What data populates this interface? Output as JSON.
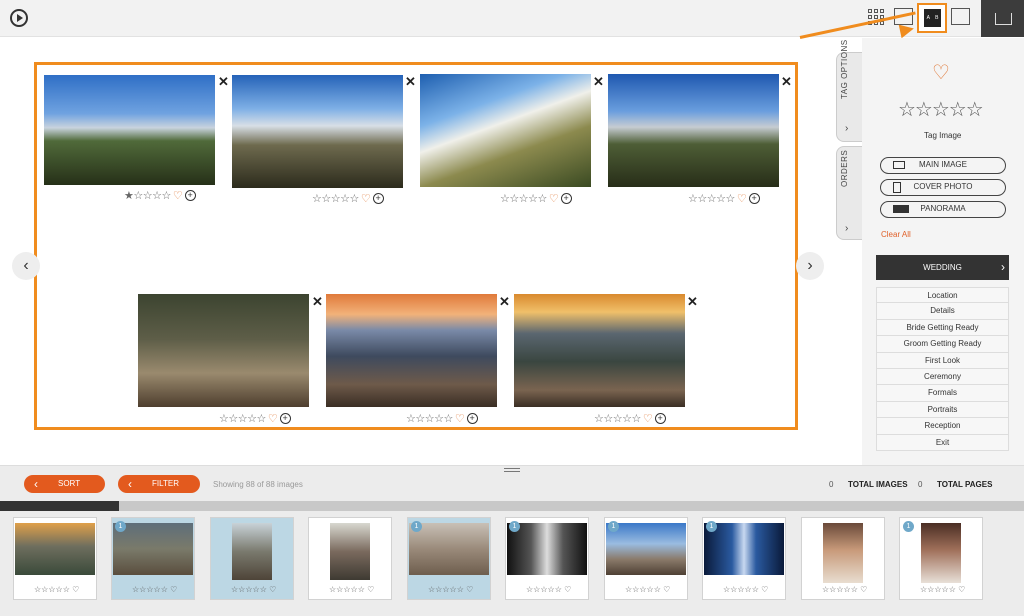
{
  "toolbar": {
    "view_buttons": [
      "grid-view-icon",
      "two-page-view-icon",
      "ab-compare-view-icon",
      "single-view-icon"
    ],
    "ab_label_a": "A",
    "ab_label_b": "B",
    "accent": "#f08c1e"
  },
  "photos": [
    {
      "rating": 1,
      "heart": "♡",
      "close": "✕",
      "plus": "+"
    },
    {
      "rating": 0,
      "heart": "♡",
      "close": "✕",
      "plus": "+"
    },
    {
      "rating": 0,
      "heart": "♡",
      "close": "✕",
      "plus": "+"
    },
    {
      "rating": 0,
      "heart": "♡",
      "close": "✕",
      "plus": "+"
    },
    {
      "rating": 0,
      "heart": "♡",
      "close": "✕",
      "plus": "+"
    },
    {
      "rating": 0,
      "heart": "♡",
      "close": "✕",
      "plus": "+"
    },
    {
      "rating": 0,
      "heart": "♡",
      "close": "✕",
      "plus": "+"
    }
  ],
  "nav": {
    "prev": "‹",
    "next": "›"
  },
  "panel": {
    "tab_tag_options": "TAG OPTIONS",
    "tab_orders": "ORDERS",
    "tab_chevron": "›",
    "heart": "♡",
    "stars": "☆☆☆☆☆",
    "tag_image": "Tag Image",
    "buttons": [
      "MAIN IMAGE",
      "COVER PHOTO",
      "PANORAMA"
    ],
    "clear_all": "Clear All",
    "wedding": "WEDDING",
    "wedding_chevron": "›",
    "categories": [
      "Location",
      "Details",
      "Bride Getting Ready",
      "Groom Getting Ready",
      "First Look",
      "Ceremony",
      "Formals",
      "Portraits",
      "Reception",
      "Exit"
    ]
  },
  "bottom": {
    "sort": "SORT",
    "filter": "FILTER",
    "showing": "Showing 88 of 88 images",
    "total_images_count": "0",
    "total_images_label": "TOTAL IMAGES",
    "total_pages_count": "0",
    "total_pages_label": "TOTAL PAGES"
  },
  "filmstrip": [
    {
      "badge": "",
      "selected": false,
      "ctrl": "☆☆☆☆☆ ♡"
    },
    {
      "badge": "1",
      "selected": true,
      "ctrl": "☆☆☆☆☆ ♡"
    },
    {
      "badge": "",
      "selected": true,
      "ctrl": "☆☆☆☆☆ ♡"
    },
    {
      "badge": "",
      "selected": false,
      "ctrl": "☆☆☆☆☆ ♡"
    },
    {
      "badge": "1",
      "selected": true,
      "ctrl": "☆☆☆☆☆ ♡"
    },
    {
      "badge": "1",
      "selected": false,
      "ctrl": "☆☆☆☆☆ ♡"
    },
    {
      "badge": "1",
      "selected": false,
      "ctrl": "☆☆☆☆☆ ♡"
    },
    {
      "badge": "1",
      "selected": false,
      "ctrl": "☆☆☆☆☆ ♡"
    },
    {
      "badge": "",
      "selected": false,
      "ctrl": "☆☆☆☆☆ ♡"
    },
    {
      "badge": "1",
      "selected": false,
      "ctrl": "☆☆☆☆☆ ♡"
    }
  ]
}
